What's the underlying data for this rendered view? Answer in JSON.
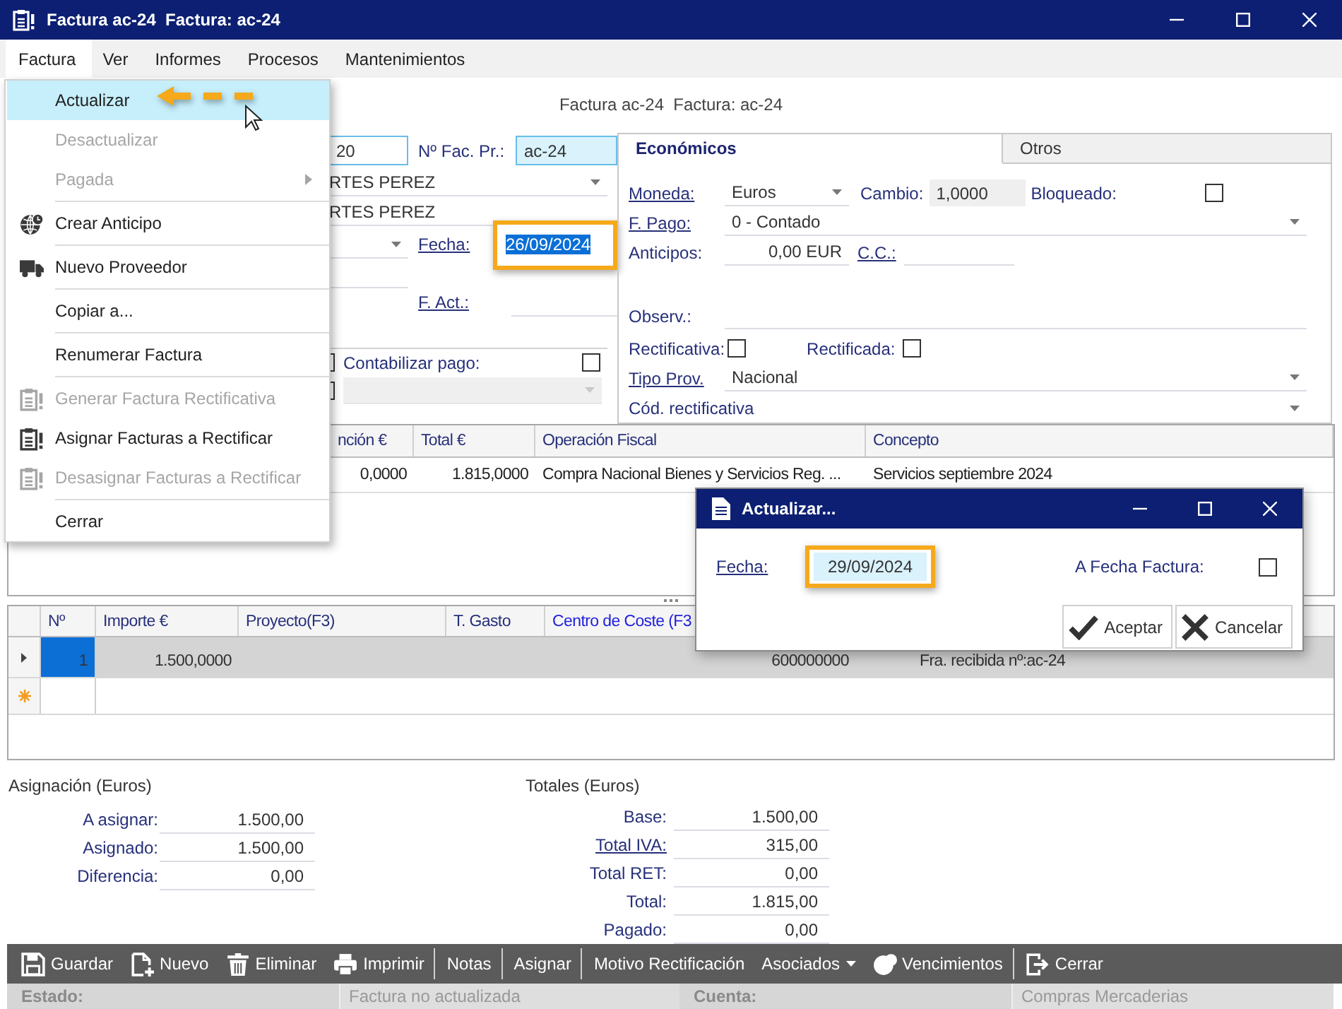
{
  "window": {
    "title": "Factura ac-24  Factura: ac-24"
  },
  "menu_bar": [
    {
      "label": "Factura",
      "selected": true
    },
    {
      "label": "Ver",
      "selected": false
    },
    {
      "label": "Informes",
      "selected": false
    },
    {
      "label": "Procesos",
      "selected": false
    },
    {
      "label": "Mantenimientos",
      "selected": false
    }
  ],
  "header_title": "Factura ac-24  Factura: ac-24",
  "left_form": {
    "field_1": {
      "value": "20"
    },
    "invoice_no": {
      "label": "Nº Fac. Pr.:",
      "link": false,
      "value": "ac-24"
    },
    "combo_1": {
      "value": "RTES PEREZ"
    },
    "field_2": {
      "value": "RTES PEREZ"
    },
    "fecha": {
      "label": "Fecha:",
      "link": true,
      "value": "26/09/2024",
      "text_selected": true,
      "highlighted": true
    },
    "f_act": {
      "label": "F. Act.:",
      "link": true
    },
    "checkbox_1": {
      "checked": false
    },
    "contabilizar_pago": {
      "label": "Contabilizar pago:",
      "checked": false
    },
    "checkbox_2": {
      "checked": false
    },
    "combo_2": {
      "disabled": true
    }
  },
  "tabs": [
    {
      "label": "Económicos",
      "selected": true
    },
    {
      "label": "Otros",
      "selected": false
    }
  ],
  "economicos": {
    "moneda": {
      "label": "Moneda:",
      "link": true,
      "value": "Euros"
    },
    "cambio": {
      "label": "Cambio:",
      "link": false,
      "value": "1,0000"
    },
    "bloqueado": {
      "label": "Bloqueado:",
      "checked": false
    },
    "f_pago": {
      "label": "F. Pago:",
      "link": true,
      "value": "0 - Contado"
    },
    "anticipos": {
      "label": "Anticipos:",
      "link": false,
      "value": "0,00 EUR"
    },
    "cc": {
      "label": "C.C.:",
      "link": true
    },
    "observ": {
      "label": "Observ.:",
      "link": false
    },
    "rectificativa": {
      "label": "Rectificativa:",
      "checked": false
    },
    "rectificada": {
      "label": "Rectificada:",
      "checked": false
    },
    "tipo_prov": {
      "label": "Tipo Prov.",
      "link": true,
      "value": "Nacional"
    },
    "cod_rectificativa": {
      "label": "Cód. rectificativa",
      "link": false
    }
  },
  "invoice_grid": {
    "columns": [
      "nción €",
      "Total €",
      "Operación Fiscal",
      "Concepto"
    ],
    "rows": [
      [
        "0,0000",
        "1.815,0000",
        "Compra Nacional Bienes y Servicios Reg. ...",
        "Servicios septiembre 2024"
      ]
    ]
  },
  "lines_grid": {
    "columns": [
      {
        "label": "Nº",
        "color": "#27307a"
      },
      {
        "label": "Importe €",
        "color": "#27307a"
      },
      {
        "label": "Proyecto(F3)",
        "color": "#27307a"
      },
      {
        "label": "T. Gasto",
        "color": "#27307a"
      },
      {
        "label": "Centro de Coste (F3",
        "color": "#2222dd"
      }
    ],
    "rows": [
      {
        "kind": "current",
        "selected": true,
        "n": "1",
        "importe": "1.500,0000",
        "centro_de_coste": "600000000",
        "column_7": "Fra. recibida nº:ac-24"
      },
      {
        "kind": "new",
        "selected": false
      }
    ]
  },
  "asignacion": {
    "title": "Asignación (Euros)",
    "rows": [
      {
        "label": "A asignar:",
        "link": false,
        "value": "1.500,00"
      },
      {
        "label": "Asignado:",
        "link": false,
        "value": "1.500,00"
      },
      {
        "label": "Diferencia:",
        "link": false,
        "value": "0,00"
      }
    ]
  },
  "totales": {
    "title": "Totales (Euros)",
    "rows": [
      {
        "label": "Base:",
        "link": false,
        "value": "1.500,00"
      },
      {
        "label": "Total IVA:",
        "link": true,
        "value": "315,00"
      },
      {
        "label": "Total RET:",
        "link": false,
        "value": "0,00"
      },
      {
        "label": "Total:",
        "link": false,
        "value": "1.815,00"
      },
      {
        "label": "Pagado:",
        "link": false,
        "value": "0,00"
      }
    ]
  },
  "toolbar": [
    {
      "label": "Guardar",
      "kind": "button",
      "separator_after": false
    },
    {
      "label": "Nuevo",
      "kind": "button",
      "separator_after": false
    },
    {
      "label": "Eliminar",
      "kind": "button",
      "separator_after": false
    },
    {
      "label": "Imprimir",
      "kind": "button",
      "separator_after": true
    },
    {
      "label": "Notas",
      "kind": "button",
      "separator_after": true
    },
    {
      "label": "Asignar",
      "kind": "button",
      "separator_after": true
    },
    {
      "label": "Motivo Rectificación",
      "kind": "button",
      "separator_after": false
    },
    {
      "label": "Asociados",
      "kind": "dropdown",
      "separator_after": false
    },
    {
      "label": "Vencimientos",
      "kind": "button",
      "separator_after": true
    },
    {
      "label": "Cerrar",
      "kind": "button",
      "separator_after": false
    }
  ],
  "status_bar": [
    {
      "label": "Estado:",
      "value": "Factura no actualizada"
    },
    {
      "label": "Cuenta:",
      "value": "Compras Mercaderias"
    }
  ],
  "factura_menu": [
    {
      "label": "Actualizar",
      "kind": "item",
      "selected": true,
      "disabled": false,
      "separator_after": false
    },
    {
      "label": "Desactualizar",
      "kind": "item",
      "selected": false,
      "disabled": true,
      "separator_after": false
    },
    {
      "label": "Pagada",
      "kind": "submenu",
      "selected": false,
      "disabled": true,
      "separator_after": true
    },
    {
      "label": "Crear Anticipo",
      "kind": "item",
      "selected": false,
      "disabled": false,
      "separator_after": true
    },
    {
      "label": "Nuevo Proveedor",
      "kind": "item",
      "selected": false,
      "disabled": false,
      "separator_after": true
    },
    {
      "label": "Copiar a...",
      "kind": "item",
      "selected": false,
      "disabled": false,
      "separator_after": true
    },
    {
      "label": "Renumerar Factura",
      "kind": "item",
      "selected": false,
      "disabled": false,
      "separator_after": true
    },
    {
      "label": "Generar Factura Rectificativa",
      "kind": "item",
      "selected": false,
      "disabled": true,
      "separator_after": false
    },
    {
      "label": "Asignar Facturas a Rectificar",
      "kind": "item",
      "selected": false,
      "disabled": false,
      "separator_after": false
    },
    {
      "label": "Desasignar Facturas a Rectificar",
      "kind": "item",
      "selected": false,
      "disabled": true,
      "separator_after": true
    },
    {
      "label": "Cerrar",
      "kind": "item",
      "selected": false,
      "disabled": false,
      "separator_after": false
    }
  ],
  "update_dialog": {
    "title": "Actualizar...",
    "fecha": {
      "label": "Fecha:",
      "link": true,
      "value": "29/09/2024",
      "highlighted": true
    },
    "a_fecha_factura": {
      "label": "A Fecha Factura:",
      "checked": false
    },
    "buttons": [
      {
        "label": "Aceptar",
        "kind": "accept"
      },
      {
        "label": "Cancelar",
        "kind": "cancel"
      }
    ]
  }
}
